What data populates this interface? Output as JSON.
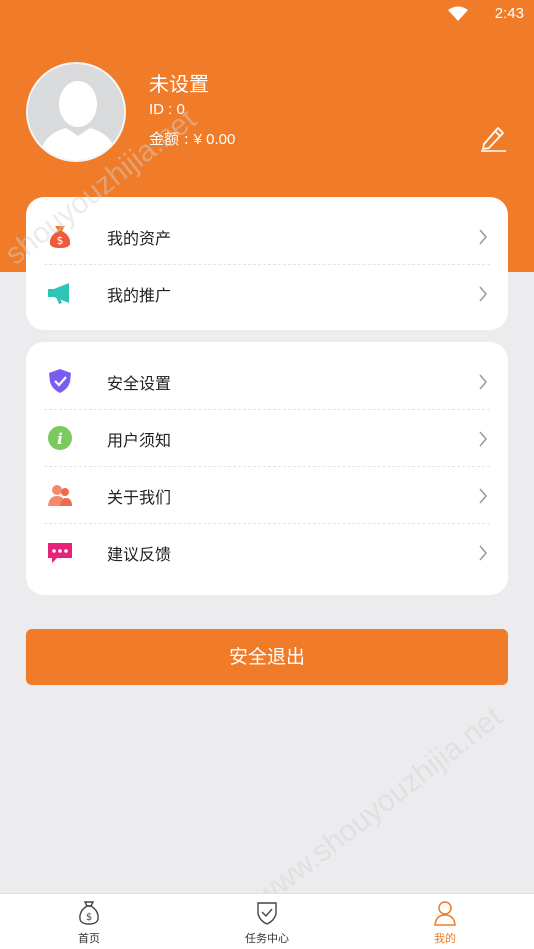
{
  "status_bar": {
    "time": "2:43"
  },
  "profile": {
    "name": "未设置",
    "id_text": "ID : 0",
    "balance_label": "金额 : ",
    "balance_value": "¥ 0.00"
  },
  "menu_group_1": [
    {
      "label": "我的资产",
      "icon": "money-bag-icon"
    },
    {
      "label": "我的推广",
      "icon": "megaphone-icon"
    }
  ],
  "menu_group_2": [
    {
      "label": "安全设置",
      "icon": "shield-icon"
    },
    {
      "label": "用户须知",
      "icon": "info-icon"
    },
    {
      "label": "关于我们",
      "icon": "people-icon"
    },
    {
      "label": "建议反馈",
      "icon": "chat-icon"
    }
  ],
  "logout_label": "安全退出",
  "tabbar": [
    {
      "label": "首页",
      "icon": "money-bag-outline-icon",
      "active": false
    },
    {
      "label": "任务中心",
      "icon": "task-shield-icon",
      "active": false
    },
    {
      "label": "我的",
      "icon": "user-icon",
      "active": true
    }
  ],
  "watermark": {
    "top": "shouyouzhijia.net",
    "bottom": "www.shouyouzhijia.net"
  },
  "colors": {
    "accent": "#f07b28",
    "background": "#ececee"
  }
}
